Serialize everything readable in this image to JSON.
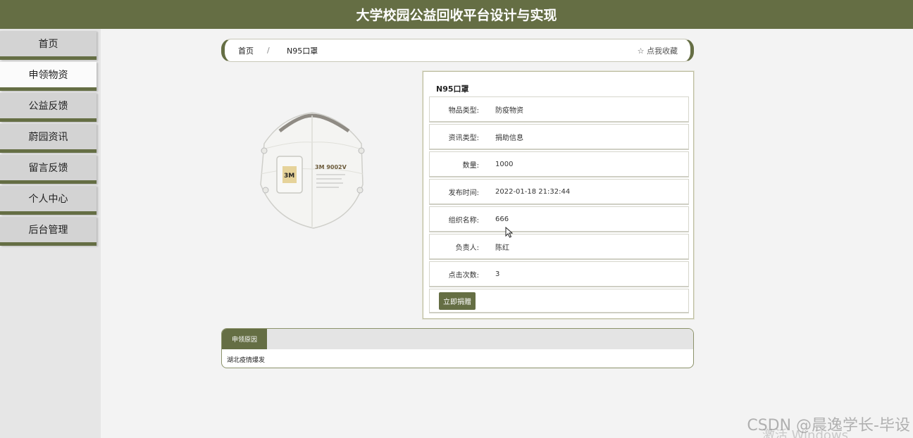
{
  "header": {
    "title": "大学校园公益回收平台设计与实现"
  },
  "sidebar": {
    "items": [
      {
        "label": "首页"
      },
      {
        "label": "申领物资"
      },
      {
        "label": "公益反馈"
      },
      {
        "label": "蔚园资讯"
      },
      {
        "label": "留言反馈"
      },
      {
        "label": "个人中心"
      },
      {
        "label": "后台管理"
      }
    ],
    "active_index": 1
  },
  "breadcrumb": {
    "home": "首页",
    "separator": "/",
    "current": "N95口罩",
    "favorite": "☆ 点我收藏"
  },
  "product": {
    "image_icon": "n95-mask-image",
    "image_text": "3M 9002V",
    "title": "N95口罩",
    "fields": [
      {
        "label": "物品类型:",
        "value": "防疫物资"
      },
      {
        "label": "资讯类型:",
        "value": "捐助信息"
      },
      {
        "label": "数量:",
        "value": "1000"
      },
      {
        "label": "发布时间:",
        "value": "2022-01-18 21:32:44"
      },
      {
        "label": "组织名称:",
        "value": "666"
      },
      {
        "label": "负责人:",
        "value": "陈红"
      },
      {
        "label": "点击次数:",
        "value": "3"
      }
    ],
    "donate_label": "立即捐赠"
  },
  "reason": {
    "tab_label": "申领原因",
    "text": "湖北疫情爆发"
  },
  "watermark": {
    "text": "CSDN @晨逸学长-毕设",
    "text2": "激活 Windows"
  },
  "colors": {
    "accent": "#656e44",
    "page_bg": "#f3f3f3"
  }
}
